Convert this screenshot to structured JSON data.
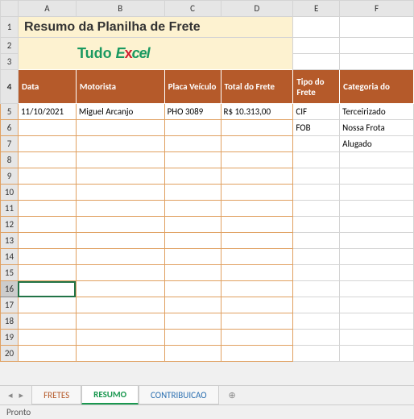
{
  "columns": [
    "A",
    "B",
    "C",
    "D",
    "E",
    "F"
  ],
  "title": "Resumo da Planilha de Frete",
  "logo": {
    "part1": "Tudo ",
    "part2": "E",
    "x": "x",
    "part3": "cel"
  },
  "headers": {
    "A": "Data",
    "B": "Motorista",
    "C": "Placa Veículo",
    "D": "Total do Frete",
    "E": "Tipo do Frete",
    "F": "Categoria do "
  },
  "rows": {
    "5": {
      "A": "11/10/2021",
      "B": "Miguel Arcanjo",
      "C": "PHO 3089",
      "D": "R$ 10.313,00",
      "E": "CIF",
      "F": "Terceirizado"
    },
    "6": {
      "E": "FOB",
      "F": "Nossa Frota"
    },
    "7": {
      "F": "Alugado"
    }
  },
  "visible_row_numbers": [
    1,
    2,
    3,
    4,
    5,
    6,
    7,
    8,
    9,
    10,
    11,
    12,
    13,
    14,
    15,
    16,
    17,
    18,
    19,
    20
  ],
  "selected_row": 16,
  "tabs": {
    "t1": "FRETES",
    "t2": "RESUMO",
    "t3": "CONTRIBUICAO"
  },
  "active_tab": "RESUMO",
  "status": "Pronto",
  "icons": {
    "nav_first": "◂",
    "nav_prev": "◂",
    "nav_next": "▸",
    "add_sheet": "⊕"
  }
}
